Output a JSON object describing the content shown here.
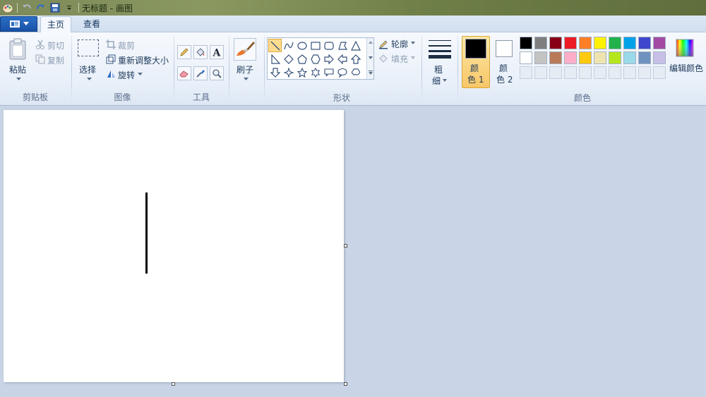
{
  "window": {
    "title": "无标题 - 画图"
  },
  "tabs": {
    "home": "主页",
    "view": "查看"
  },
  "clipboard": {
    "paste": "粘贴",
    "cut": "剪切",
    "copy": "复制",
    "group": "剪贴板"
  },
  "image": {
    "select": "选择",
    "crop": "裁剪",
    "resize": "重新调整大小",
    "rotate": "旋转",
    "group": "图像"
  },
  "tools": {
    "group": "工具"
  },
  "brushes": {
    "label": "刷子"
  },
  "shapes": {
    "outline": "轮廓",
    "fill": "填充",
    "group": "形状"
  },
  "size": {
    "label_1": "粗",
    "label_2": "细"
  },
  "colors": {
    "color1_a": "颜",
    "color1_b": "色 1",
    "color2_a": "颜",
    "color2_b": "色 2",
    "edit": "编辑颜色",
    "group": "颜色",
    "color1_value": "#000000",
    "color2_value": "#ffffff",
    "palette_row1": [
      "#000000",
      "#7f7f7f",
      "#880015",
      "#ed1c24",
      "#ff7f27",
      "#fff200",
      "#22b14c",
      "#00a2e8",
      "#3f48cc",
      "#a349a4"
    ],
    "palette_row2": [
      "#ffffff",
      "#c3c3c3",
      "#b97a57",
      "#ffaec9",
      "#ffc90e",
      "#efe4b0",
      "#b5e61d",
      "#99d9ea",
      "#7092be",
      "#c8bfe7"
    ]
  }
}
